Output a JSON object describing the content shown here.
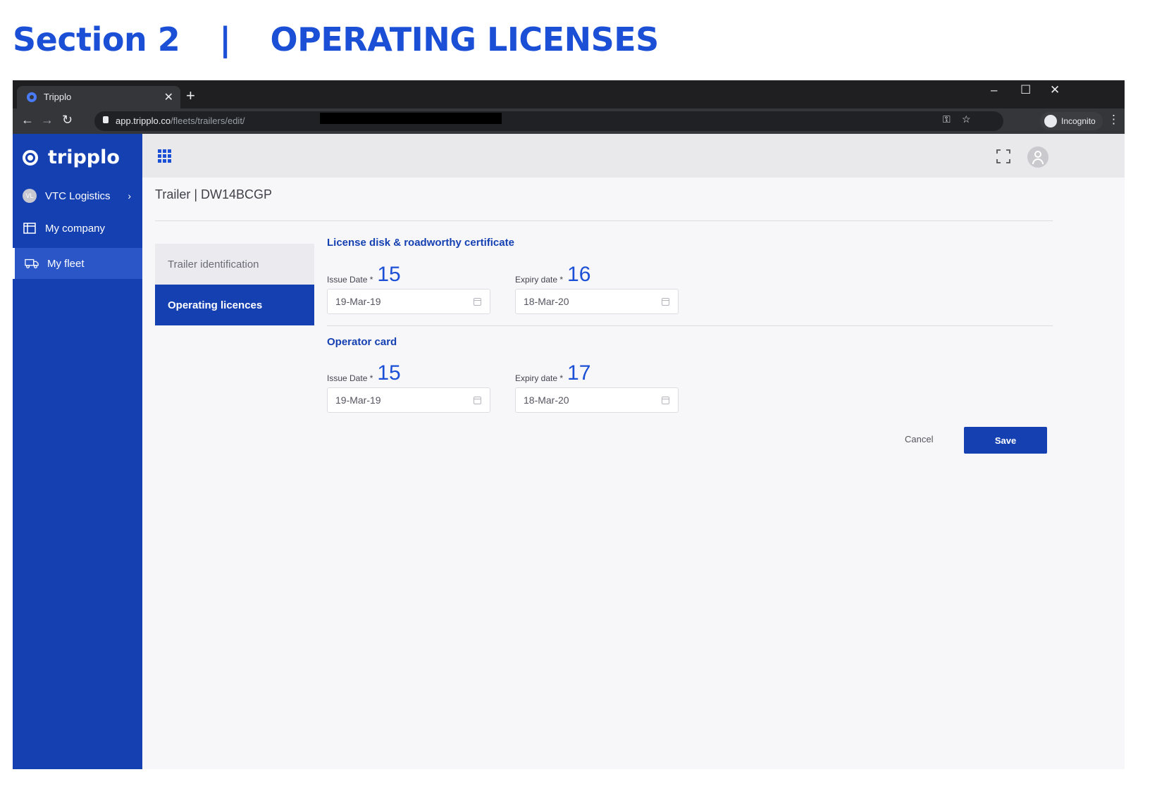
{
  "heading": {
    "section": "Section 2",
    "separator": "|",
    "title": "OPERATING LICENSES"
  },
  "browser": {
    "tab_title": "Tripplo",
    "tab_close": "✕",
    "new_tab": "+",
    "url_host": "app.tripplo.co",
    "url_path": "/fleets/trailers/edit/",
    "incognito_label": "Incognito"
  },
  "app": {
    "logo_text": "tripplo"
  },
  "sidebar": {
    "items": [
      {
        "label": "VTC Logistics",
        "avatar": "VL"
      },
      {
        "label": "My company"
      },
      {
        "label": "My fleet"
      }
    ]
  },
  "page": {
    "title": "Trailer | DW14BCGP",
    "tabs": [
      {
        "label": "Trailer identification"
      },
      {
        "label": "Operating licences"
      }
    ]
  },
  "license_disk": {
    "title": "License disk & roadworthy certificate",
    "issue_label": "Issue Date *",
    "issue_num": "15",
    "issue_value": "19-Mar-19",
    "expiry_label": "Expiry date *",
    "expiry_num": "16",
    "expiry_value": "18-Mar-20"
  },
  "operator_card": {
    "title": "Operator card",
    "issue_label": "Issue Date *",
    "issue_num": "15",
    "issue_value": "19-Mar-19",
    "expiry_label": "Expiry date *",
    "expiry_num": "17",
    "expiry_value": "18-Mar-20"
  },
  "actions": {
    "cancel": "Cancel",
    "save": "Save"
  },
  "colors": {
    "brand": "#1540b2",
    "annotation": "#1a4fd6"
  }
}
